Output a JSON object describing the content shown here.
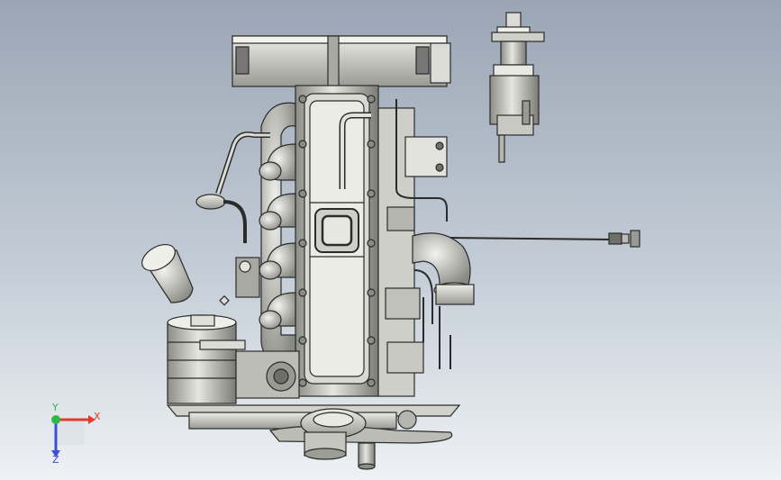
{
  "viewport": {
    "background_top": "#9aa6b5",
    "background_bottom": "#eef1f4"
  },
  "model": {
    "name": "engine-assembly",
    "metal_color": "#c8c8c2",
    "metal_dark": "#6e6e6a",
    "edge_color": "#2b2b2b"
  },
  "triad": {
    "x_label": "X",
    "y_label": "Y",
    "z_label": "Z",
    "x_color": "#e23b2e",
    "y_color": "#2fb84a",
    "z_color": "#3b4fd6"
  }
}
